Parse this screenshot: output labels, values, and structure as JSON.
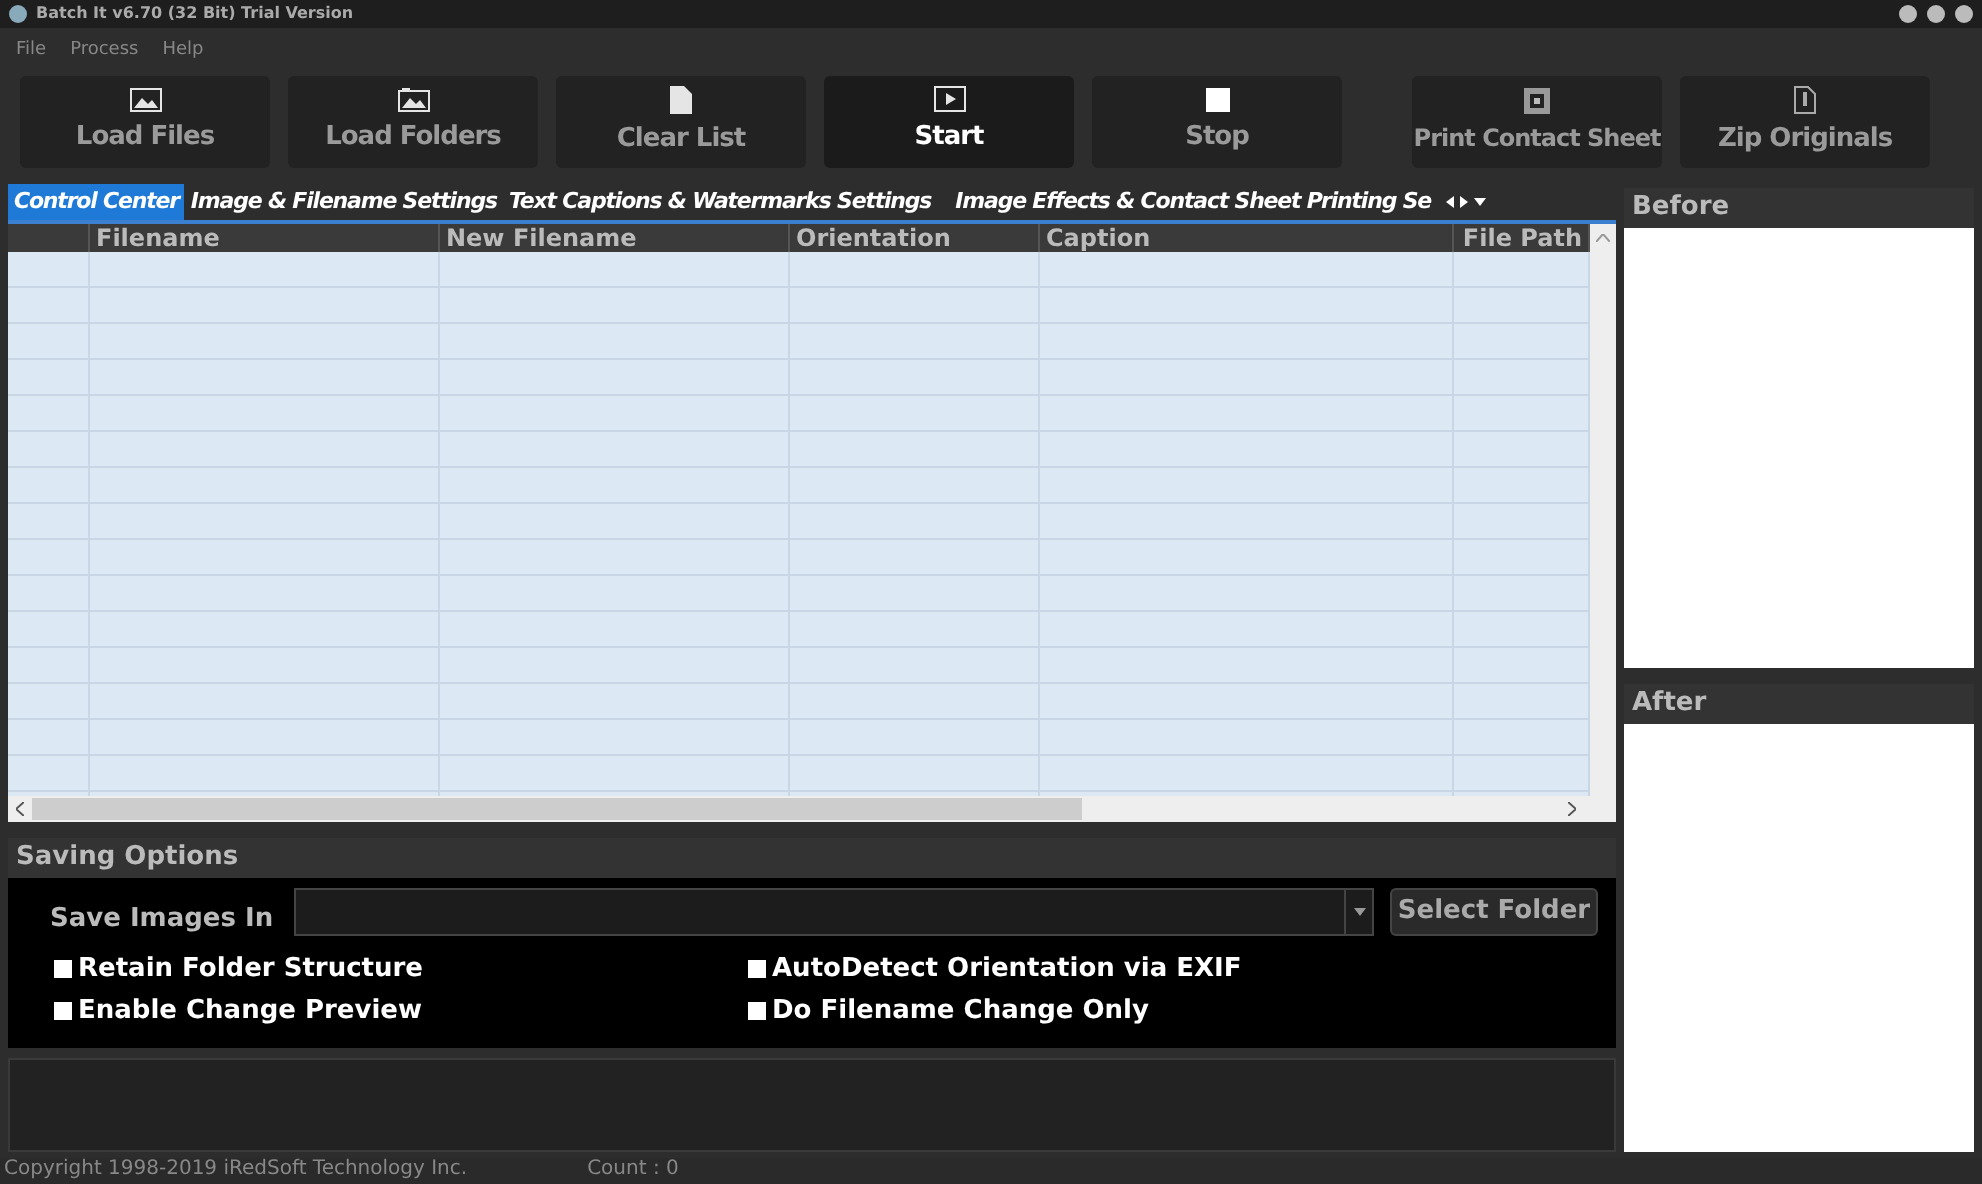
{
  "window": {
    "title": "Batch It v6.70 (32 Bit) Trial Version"
  },
  "menu": [
    "File",
    "Process",
    "Help"
  ],
  "toolbar": [
    {
      "label": "Load Files",
      "kind": "image",
      "selected": false
    },
    {
      "label": "Load Folders",
      "kind": "folder",
      "selected": false
    },
    {
      "label": "Clear List",
      "kind": "page",
      "selected": false
    },
    {
      "label": "Start",
      "kind": "play",
      "selected": true
    },
    {
      "label": "Stop",
      "kind": "stop",
      "selected": false
    },
    {
      "label": "Print Contact Sheet",
      "kind": "grid",
      "selected": false
    },
    {
      "label": "Zip Originals",
      "kind": "zip",
      "selected": false
    }
  ],
  "tabs": [
    {
      "label": "Control Center",
      "selected": true
    },
    {
      "label": "Image & Filename Settings",
      "selected": false
    },
    {
      "label": "Text Captions & Watermarks Settings",
      "selected": false
    },
    {
      "label": "Image Effects & Contact Sheet Printing Se",
      "selected": false
    }
  ],
  "table": {
    "columns": [
      "Filename",
      "New Filename",
      "Orientation",
      "Caption",
      "File Path"
    ]
  },
  "saving_options": {
    "title": "Saving Options",
    "save_label": "Save Images In",
    "select_button": "Select Folder",
    "options": [
      {
        "label": "Retain Folder Structure",
        "checked": false
      },
      {
        "label": "AutoDetect Orientation via EXIF",
        "checked": false
      },
      {
        "label": "Enable Change Preview",
        "checked": false
      },
      {
        "label": "Do Filename Change Only",
        "checked": false
      }
    ]
  },
  "preview": {
    "before": "Before",
    "after": "After"
  },
  "status_bar": {
    "copyright": "Copyright 1998-2019 iRedSoft Technology Inc.",
    "count": "Count : 0"
  }
}
